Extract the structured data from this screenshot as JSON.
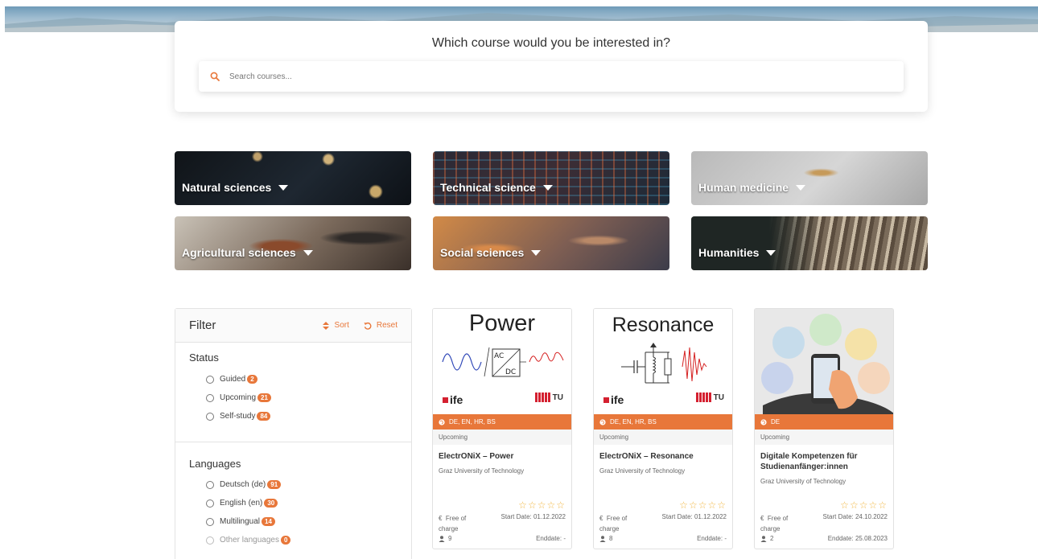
{
  "search": {
    "heading": "Which course would you be interested in?",
    "placeholder": "Search courses..."
  },
  "categories": [
    {
      "label": "Natural sciences"
    },
    {
      "label": "Technical science"
    },
    {
      "label": "Human medicine"
    },
    {
      "label": "Agricultural sciences"
    },
    {
      "label": "Social sciences"
    },
    {
      "label": "Humanities"
    }
  ],
  "filter": {
    "title": "Filter",
    "sort_label": "Sort",
    "reset_label": "Reset",
    "status": {
      "title": "Status",
      "options": [
        {
          "label": "Guided",
          "count": "2"
        },
        {
          "label": "Upcoming",
          "count": "21"
        },
        {
          "label": "Self-study",
          "count": "84"
        }
      ]
    },
    "languages": {
      "title": "Languages",
      "options": [
        {
          "label": "Deutsch (de)",
          "count": "91"
        },
        {
          "label": "English (en)",
          "count": "30"
        },
        {
          "label": "Multilingual",
          "count": "14"
        },
        {
          "label": "Other languages",
          "count": "0"
        }
      ]
    }
  },
  "courses": [
    {
      "image_word": "Power",
      "languages": "DE, EN, HR, BS",
      "status": "Upcoming",
      "title": "ElectrONiX – Power",
      "university": "Graz University of Technology",
      "price": "Free of charge",
      "start": "Start Date: 01.12.2022",
      "participants": "9",
      "end": "Enddate: -"
    },
    {
      "image_word": "Resonance",
      "languages": "DE, EN, HR, BS",
      "status": "Upcoming",
      "title": "ElectrONiX – Resonance",
      "university": "Graz University of Technology",
      "price": "Free of charge",
      "start": "Start Date: 01.12.2022",
      "participants": "8",
      "end": "Enddate: -"
    },
    {
      "languages": "DE",
      "status": "Upcoming",
      "title": "Digitale Kompetenzen für Studienanfänger:innen",
      "university": "Graz University of Technology",
      "price": "Free of charge",
      "start": "Start Date: 24.10.2022",
      "participants": "2",
      "end": "Enddate: 25.08.2023"
    }
  ],
  "logos": {
    "ife": "ife",
    "tu": "TU"
  },
  "colors": {
    "accent": "#e8773a",
    "star": "#f1b640"
  }
}
